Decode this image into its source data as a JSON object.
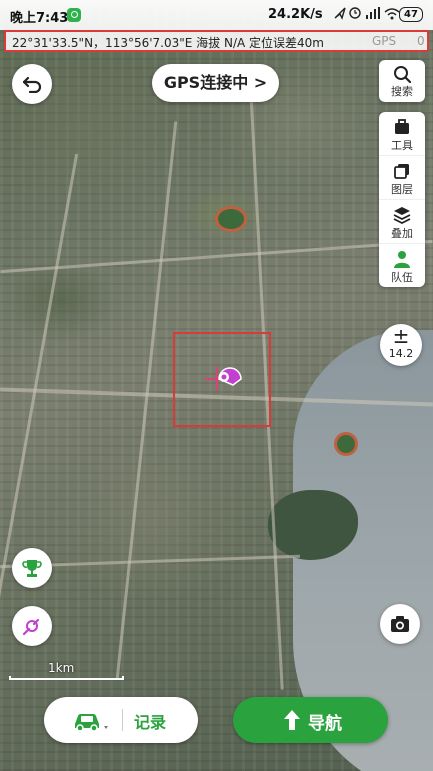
{
  "status_bar": {
    "time": "晚上7:43",
    "network_speed": "24.2K/s",
    "battery": "47"
  },
  "location_info": {
    "coordinates_text": "22°31'33.5\"N，113°56'7.03\"E  海拔 N/A  定位误差40m",
    "gps_label": "GPS",
    "satellite_count": "0"
  },
  "top": {
    "gps_status": "GPS连接中 >"
  },
  "side_panel": {
    "search": "搜索",
    "tools": "工具",
    "layers": "图层",
    "overlay": "叠加",
    "team": "队伍"
  },
  "zoom": {
    "level": "14.2"
  },
  "scale": {
    "label": "1km"
  },
  "bottom": {
    "record": "记录",
    "navigate": "导航"
  },
  "colors": {
    "accent_green": "#2aa33f",
    "highlight_red": "#d93a3a",
    "marker_purple": "#c23fd0"
  }
}
